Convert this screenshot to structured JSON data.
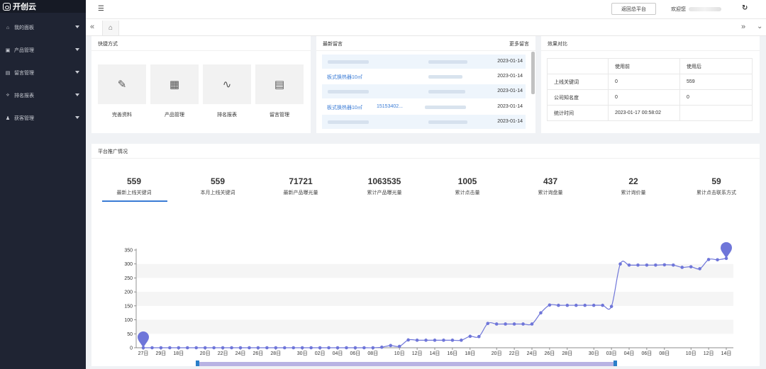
{
  "brand": {
    "name": "开创云"
  },
  "sidebar": {
    "items": [
      {
        "label": "我的面板",
        "icon": "⌂"
      },
      {
        "label": "产品管理",
        "icon": "▣"
      },
      {
        "label": "留言管理",
        "icon": "▤"
      },
      {
        "label": "排名报表",
        "icon": "⟡"
      },
      {
        "label": "获客管理",
        "icon": "♟"
      }
    ]
  },
  "topbar": {
    "back_label": "返回总平台",
    "welcome_label": "欢迎您"
  },
  "quick": {
    "title": "快捷方式",
    "items": [
      {
        "label": "完善资料",
        "icon": "✎"
      },
      {
        "label": "产品管理",
        "icon": "▦"
      },
      {
        "label": "排名报表",
        "icon": "∿"
      },
      {
        "label": "留言管理",
        "icon": "▤"
      }
    ]
  },
  "messages": {
    "title": "最新留言",
    "more": "更多留言",
    "rows": [
      {
        "title": "",
        "phone": "",
        "date": "2023-01-14"
      },
      {
        "title": "板式换热器10㎡",
        "phone": "",
        "date": "2023-01-14"
      },
      {
        "title": "",
        "phone": "",
        "date": "2023-01-14"
      },
      {
        "title": "板式换热器10㎡",
        "phone": "15153402...",
        "date": "2023-01-14"
      },
      {
        "title": "",
        "phone": "",
        "date": "2023-01-14"
      }
    ]
  },
  "compare": {
    "title": "效果对比",
    "header": [
      "",
      "使用前",
      "使用后"
    ],
    "rows": [
      [
        "上线关键词",
        "0",
        "559"
      ],
      [
        "公司知名度",
        "0",
        "0"
      ],
      [
        "统计时间",
        "2023-01-17 00:58:02",
        ""
      ]
    ]
  },
  "overview": {
    "title": "平台推广情况",
    "stats": [
      {
        "value": "559",
        "label": "最新上线关键词"
      },
      {
        "value": "559",
        "label": "本月上线关键词"
      },
      {
        "value": "71721",
        "label": "最新产品曝光量"
      },
      {
        "value": "1063535",
        "label": "累计产品曝光量"
      },
      {
        "value": "1005",
        "label": "累计点击量"
      },
      {
        "value": "437",
        "label": "累计询盘量"
      },
      {
        "value": "22",
        "label": "累计询价量"
      },
      {
        "value": "59",
        "label": "累计点击联系方式"
      }
    ]
  },
  "chart_data": {
    "type": "line",
    "title": "",
    "xlabel": "",
    "ylabel": "",
    "ylim": [
      0,
      350
    ],
    "yticks": [
      0,
      50,
      100,
      150,
      200,
      250,
      300,
      350
    ],
    "x_tick_labels": [
      "27日",
      "29日",
      "18日",
      "20日",
      "22日",
      "24日",
      "26日",
      "28日",
      "30日",
      "02日",
      "04日",
      "06日",
      "08日",
      "10日",
      "12日",
      "14日",
      "16日",
      "18日",
      "20日",
      "22日",
      "24日",
      "26日",
      "28日",
      "30日",
      "03日",
      "04日",
      "06日",
      "08日",
      "10日",
      "12日",
      "14日"
    ],
    "series": [
      {
        "color": "#6f76d9",
        "values": [
          0,
          0,
          0,
          0,
          0,
          0,
          0,
          0,
          0,
          0,
          0,
          0,
          0,
          0,
          0,
          0,
          0,
          0,
          0,
          0,
          0,
          0,
          0,
          0,
          0,
          0,
          0,
          2,
          8,
          5,
          28,
          27,
          27,
          27,
          27,
          27,
          27,
          41,
          40,
          87,
          85,
          85,
          85,
          85,
          85,
          125,
          153,
          152,
          152,
          152,
          152,
          152,
          152,
          148,
          300,
          296,
          296,
          296,
          296,
          297,
          296,
          288,
          290,
          283,
          316,
          315,
          320
        ]
      }
    ],
    "markers": [
      {
        "type": "min",
        "value": 0
      },
      {
        "type": "max",
        "value": 320
      }
    ],
    "grid": true
  }
}
